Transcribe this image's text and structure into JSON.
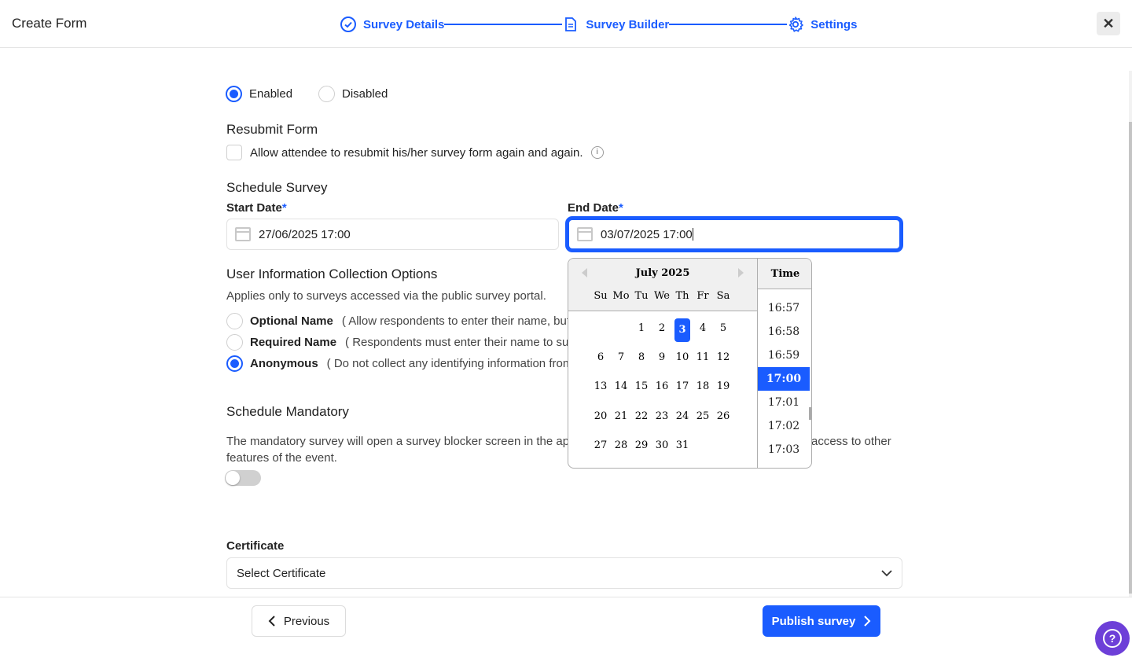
{
  "header": {
    "title": "Create Form",
    "steps": [
      {
        "label": "Survey Details",
        "icon": "check-circle-icon"
      },
      {
        "label": "Survey Builder",
        "icon": "document-icon"
      },
      {
        "label": "Settings",
        "icon": "gear-icon"
      }
    ],
    "close_icon": "close-icon"
  },
  "status": {
    "enabled_label": "Enabled",
    "disabled_label": "Disabled",
    "selected": "Enabled"
  },
  "resubmit": {
    "title": "Resubmit Form",
    "checkbox_label": "Allow attendee to resubmit his/her survey form again and again.",
    "checked": false
  },
  "schedule": {
    "title": "Schedule Survey",
    "start_label": "Start Date",
    "start_value": "27/06/2025 17:00",
    "end_label": "End Date",
    "end_value": "03/07/2025 17:00",
    "required_mark": "*"
  },
  "user_info": {
    "title": "User Information Collection Options",
    "subtitle": "Applies only to surveys accessed via the public survey portal.",
    "options": [
      {
        "label": "Optional Name",
        "desc": "( Allow respondents to enter their name, but",
        "selected": false
      },
      {
        "label": "Required Name",
        "desc": "( Respondents must enter their name to sub",
        "selected": false
      },
      {
        "label": "Anonymous",
        "desc": "( Do not collect any identifying information from",
        "selected": true
      }
    ]
  },
  "mandatory": {
    "title": "Schedule Mandatory",
    "desc_left": "The mandatory survey will open a survey blocker screen in the ap",
    "desc_right": "access to other",
    "desc_line2": "features of the event.",
    "toggle_on": false
  },
  "certificate": {
    "label": "Certificate",
    "placeholder": "Select Certificate"
  },
  "datepicker": {
    "month": "July 2025",
    "dow": [
      "Su",
      "Mo",
      "Tu",
      "We",
      "Th",
      "Fr",
      "Sa"
    ],
    "weeks": [
      [
        "",
        "",
        "1",
        "2",
        "3",
        "4",
        "5"
      ],
      [
        "6",
        "7",
        "8",
        "9",
        "10",
        "11",
        "12"
      ],
      [
        "13",
        "14",
        "15",
        "16",
        "17",
        "18",
        "19"
      ],
      [
        "20",
        "21",
        "22",
        "23",
        "24",
        "25",
        "26"
      ],
      [
        "27",
        "28",
        "29",
        "30",
        "31",
        "",
        ""
      ]
    ],
    "selected_day": "3",
    "time_header": "Time",
    "times": [
      "16:57",
      "16:58",
      "16:59",
      "17:00",
      "17:01",
      "17:02",
      "17:03"
    ],
    "selected_time": "17:00"
  },
  "footer": {
    "previous_label": "Previous",
    "publish_label": "Publish survey"
  },
  "help": {
    "label": "?"
  }
}
